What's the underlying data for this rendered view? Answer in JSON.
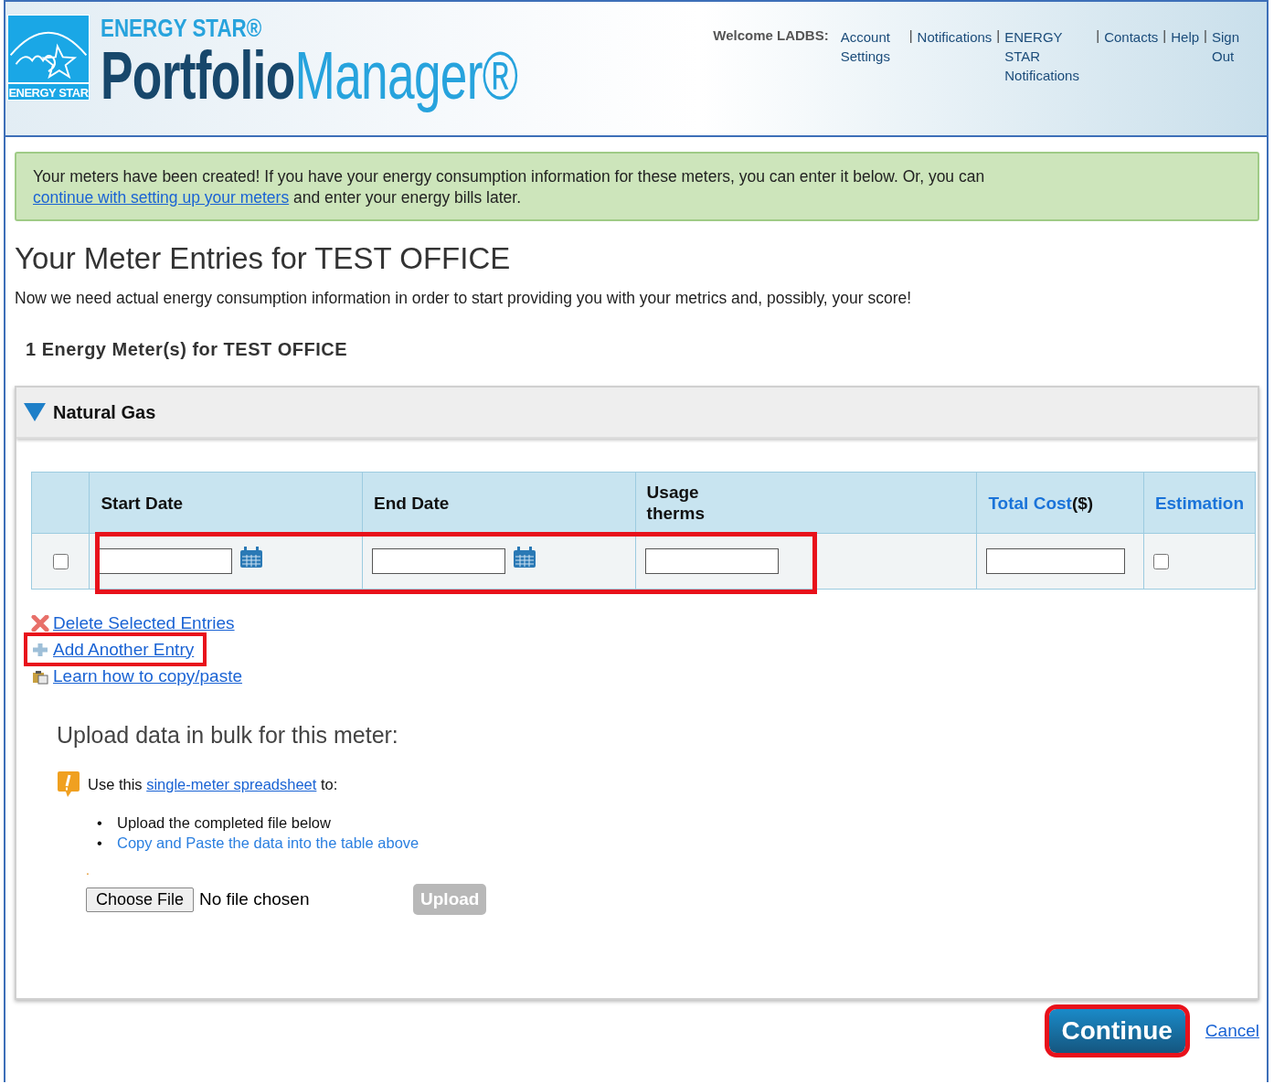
{
  "header": {
    "brand_top": "ENERGY STAR®",
    "brand_bold": "Portfolio",
    "brand_light": "Manager®",
    "logo_text": "ENERGY STAR",
    "welcome": "Welcome LADBS:",
    "separator": "|",
    "nav": [
      {
        "label": "Account Settings"
      },
      {
        "label": "Notifications"
      },
      {
        "label": "ENERGY STAR Notifications"
      },
      {
        "label": "Contacts"
      },
      {
        "label": "Help"
      },
      {
        "label": "Sign Out"
      }
    ]
  },
  "notice": {
    "text": "Your meters have been created! If you have your energy consumption information for these meters, you can enter it below. Or, you can",
    "link": "continue with setting up your meters",
    "after": "and enter your energy bills later."
  },
  "title": "Your Meter Entries for TEST OFFICE",
  "intro": "Now we need actual energy consumption information in order to start providing you with your metrics and, possibly, your score!",
  "meters_heading": "1 Energy Meter(s) for TEST OFFICE",
  "meter": {
    "name": "Natural Gas",
    "expanded": true,
    "columns": [
      {
        "label": "Start Date",
        "kind": "plain"
      },
      {
        "label": "End Date",
        "kind": "plain"
      },
      {
        "label": "Usage",
        "unit": "therms",
        "kind": "unit"
      },
      {
        "label": "Total Cost",
        "suffix": "($)",
        "kind": "link"
      },
      {
        "label": "Estimation",
        "kind": "link"
      }
    ],
    "rows": [
      {
        "selected": false,
        "start_date": "",
        "end_date": "",
        "usage": "",
        "total_cost": "",
        "estimation": false,
        "highlighted": true
      }
    ],
    "actions": [
      {
        "label": "Delete Selected Entries",
        "kind": "delete",
        "highlighted": false
      },
      {
        "label": "Add Another Entry",
        "kind": "add",
        "highlighted": true
      },
      {
        "label": "Learn how to copy/paste",
        "kind": "help",
        "highlighted": false
      }
    ],
    "upload": {
      "heading": "Upload data in bulk for this meter:",
      "lead": "Use this",
      "link": "single-meter spreadsheet",
      "after": "to:",
      "bullet_marker": "•",
      "bullets": [
        {
          "text": "Upload the completed file below",
          "kind": "plain"
        },
        {
          "text": "Copy and Paste the data into the table above",
          "kind": "link"
        }
      ],
      "mark": ".",
      "choose": "Choose File",
      "file_status": "No file chosen",
      "upload_button": "Upload",
      "upload_disabled": true
    }
  },
  "footer": {
    "continue": "Continue",
    "continue_highlighted": true,
    "cancel": "Cancel"
  }
}
